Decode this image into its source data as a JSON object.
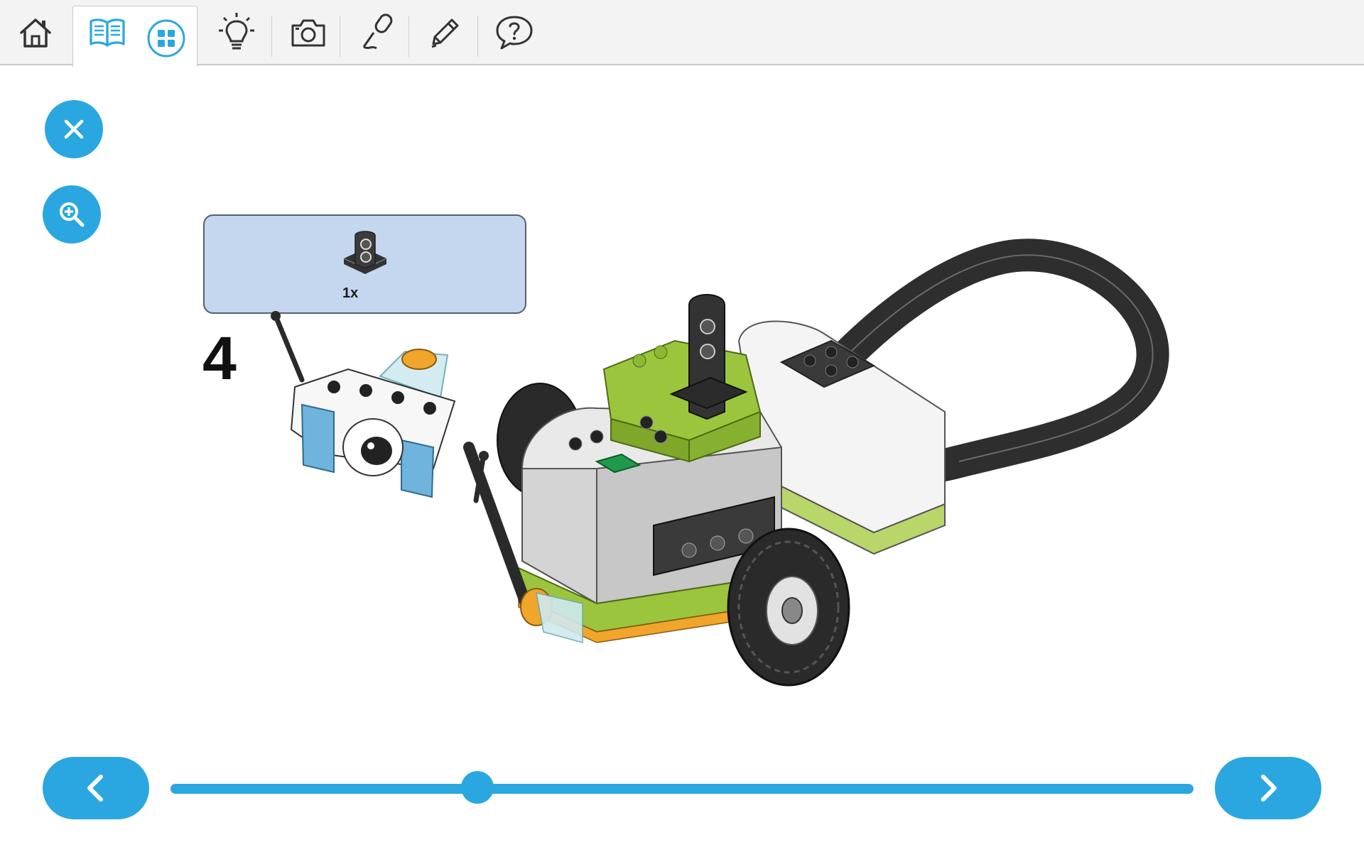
{
  "toolbar": {
    "items": [
      {
        "icon": "home-icon"
      },
      {
        "icon": "book-icon",
        "active": true
      },
      {
        "icon": "grid-icon"
      },
      {
        "icon": "lightbulb-icon"
      },
      {
        "icon": "camera-icon"
      },
      {
        "icon": "microphone-icon"
      },
      {
        "icon": "pencil-icon"
      },
      {
        "icon": "help-bubble-icon"
      }
    ]
  },
  "side_buttons": {
    "close_icon": "close-icon",
    "zoom_icon": "zoom-in-icon"
  },
  "parts": {
    "count_label": "1x",
    "part_icon": "black-axle-connector-part"
  },
  "step": {
    "number": "4"
  },
  "navigation": {
    "prev_icon": "chevron-left-icon",
    "next_icon": "chevron-right-icon",
    "progress_fraction": 0.3
  },
  "colors": {
    "accent": "#2aa7e0",
    "parts_box": "#c4d7ee",
    "lime": "#9bc53d",
    "gray": "#c7c7c7"
  }
}
